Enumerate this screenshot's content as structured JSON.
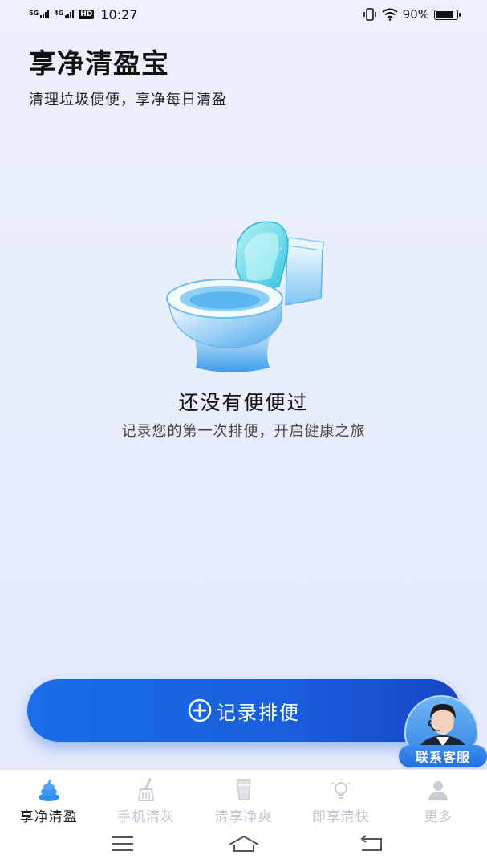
{
  "status_bar": {
    "net1": "5G",
    "net2": "4G",
    "hd": "HD",
    "time": "10:27",
    "battery_text": "90%",
    "battery_level": 0.9
  },
  "header": {
    "title": "享净清盈宝",
    "subtitle": "清理垃圾便便，享净每日清盈"
  },
  "empty_state": {
    "icon": "toilet-illustration",
    "title": "还没有便便过",
    "description": "记录您的第一次排便，开启健康之旅"
  },
  "record_button": {
    "icon": "plus-circle-icon",
    "label": "记录排便"
  },
  "customer_service": {
    "label": "联系客服",
    "icon": "agent-avatar"
  },
  "tabs": [
    {
      "label": "享净清盈",
      "icon": "poop-icon",
      "active": true
    },
    {
      "label": "手机清灰",
      "icon": "broom-icon",
      "active": false
    },
    {
      "label": "清享净爽",
      "icon": "cup-icon",
      "active": false
    },
    {
      "label": "即享清快",
      "icon": "bulb-icon",
      "active": false
    },
    {
      "label": "更多",
      "icon": "person-icon",
      "active": false
    }
  ],
  "system_nav": [
    "menu-icon",
    "home-icon",
    "back-icon"
  ],
  "colors": {
    "accent": "#1a5fdc",
    "active_tab_icon": "#2f8ef0",
    "inactive": "#c3c7cf"
  }
}
